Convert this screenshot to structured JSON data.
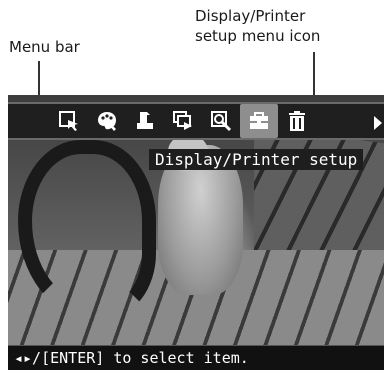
{
  "callouts": {
    "menu_bar": "Menu bar",
    "setup_line1": "Display/Printer",
    "setup_line2": "setup menu icon"
  },
  "menu": {
    "items": [
      {
        "icon": "select-icon",
        "glyph": "◪"
      },
      {
        "icon": "palette-icon",
        "glyph": "✿"
      },
      {
        "icon": "print-icon",
        "glyph": "▙"
      },
      {
        "icon": "slideshow-icon",
        "glyph": "⧉"
      },
      {
        "icon": "search-icon",
        "glyph": "◩"
      },
      {
        "icon": "toolbox-icon",
        "glyph": "▣"
      },
      {
        "icon": "trash-icon",
        "glyph": "🗑"
      }
    ],
    "active_index": 5,
    "more_icon": "arrow-right-icon"
  },
  "tooltip": "Display/Printer setup",
  "status": "◂▸/[ENTER] to select item."
}
